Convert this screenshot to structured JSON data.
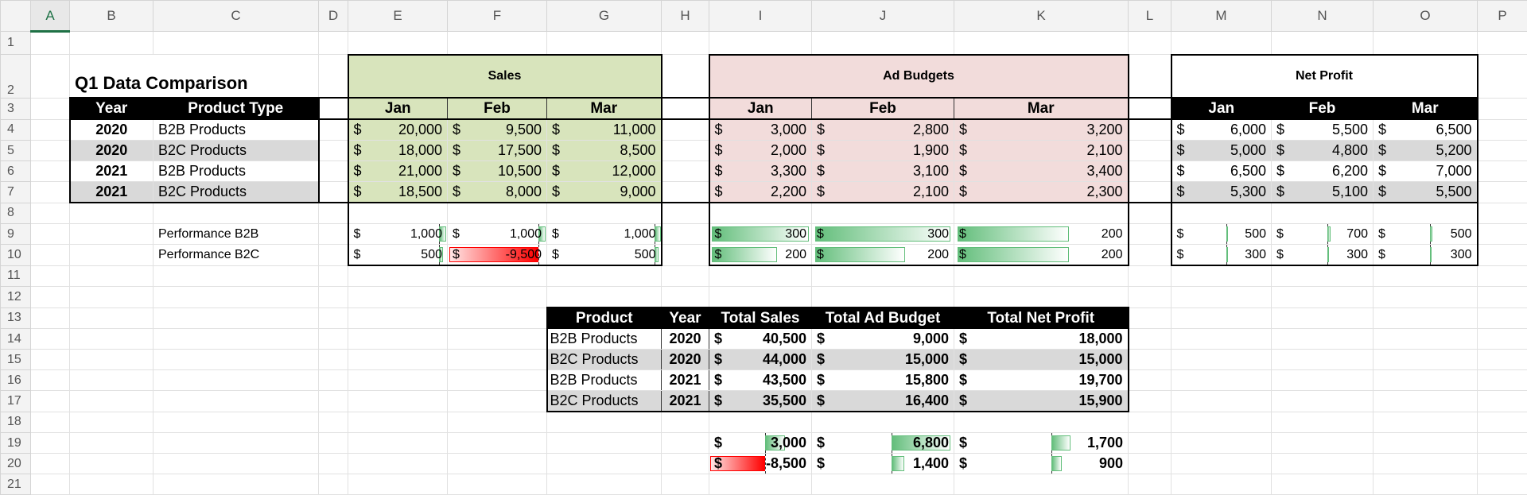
{
  "columns": [
    "A",
    "B",
    "C",
    "D",
    "E",
    "F",
    "G",
    "H",
    "I",
    "J",
    "K",
    "L",
    "M",
    "N",
    "O",
    "P"
  ],
  "rows": [
    "1",
    "2",
    "3",
    "4",
    "5",
    "6",
    "7",
    "8",
    "9",
    "10",
    "11",
    "12",
    "13",
    "14",
    "15",
    "16",
    "17",
    "18",
    "19",
    "20",
    "21"
  ],
  "currency": "$",
  "title": "Q1 Data Comparison",
  "left_table": {
    "headers": [
      "Year",
      "Product Type"
    ],
    "rows": [
      {
        "year": "2020",
        "product": "B2B Products"
      },
      {
        "year": "2020",
        "product": "B2C Products"
      },
      {
        "year": "2021",
        "product": "B2B Products"
      },
      {
        "year": "2021",
        "product": "B2C Products"
      }
    ],
    "performance_labels": [
      "Performance B2B",
      "Performance B2C"
    ]
  },
  "sales": {
    "title": "Sales",
    "months": [
      "Jan",
      "Feb",
      "Mar"
    ],
    "rows": [
      [
        "20,000",
        "9,500",
        "11,000"
      ],
      [
        "18,000",
        "17,500",
        "8,500"
      ],
      [
        "21,000",
        "10,500",
        "12,000"
      ],
      [
        "18,500",
        "8,000",
        "9,000"
      ]
    ],
    "performance": [
      [
        "1,000",
        "1,000",
        "1,000"
      ],
      [
        "500",
        "-9,500",
        "500"
      ]
    ]
  },
  "ad_budgets": {
    "title": "Ad Budgets",
    "months": [
      "Jan",
      "Feb",
      "Mar"
    ],
    "rows": [
      [
        "3,000",
        "2,800",
        "3,200"
      ],
      [
        "2,000",
        "1,900",
        "2,100"
      ],
      [
        "3,300",
        "3,100",
        "3,400"
      ],
      [
        "2,200",
        "2,100",
        "2,300"
      ]
    ],
    "performance": [
      [
        "300",
        "300",
        "200"
      ],
      [
        "200",
        "200",
        "200"
      ]
    ]
  },
  "net_profit": {
    "title": "Net Profit",
    "months": [
      "Jan",
      "Feb",
      "Mar"
    ],
    "rows": [
      [
        "6,000",
        "5,500",
        "6,500"
      ],
      [
        "5,000",
        "4,800",
        "5,200"
      ],
      [
        "6,500",
        "6,200",
        "7,000"
      ],
      [
        "5,300",
        "5,100",
        "5,500"
      ]
    ],
    "performance": [
      [
        "500",
        "700",
        "500"
      ],
      [
        "300",
        "300",
        "300"
      ]
    ]
  },
  "summary": {
    "headers": [
      "Product",
      "Year",
      "Total Sales",
      "Total Ad Budget",
      "Total Net Profit"
    ],
    "rows": [
      {
        "product": "B2B Products",
        "year": "2020",
        "sales": "40,500",
        "ad": "9,000",
        "profit": "18,000"
      },
      {
        "product": "B2C Products",
        "year": "2020",
        "sales": "44,000",
        "ad": "15,000",
        "profit": "15,000"
      },
      {
        "product": "B2B Products",
        "year": "2021",
        "sales": "43,500",
        "ad": "15,800",
        "profit": "19,700"
      },
      {
        "product": "B2C Products",
        "year": "2021",
        "sales": "35,500",
        "ad": "16,400",
        "profit": "15,900"
      }
    ],
    "differences": [
      [
        "3,000",
        "6,800",
        "1,700"
      ],
      [
        "-8,500",
        "1,400",
        "900"
      ]
    ]
  },
  "colors": {
    "sales_fill": "#d8e4bc",
    "ad_fill": "#f2dcdb",
    "band": "#d9d9d9",
    "positive_bar": "#63be7b",
    "negative_bar": "#ff0000",
    "selected_column": "#1e7145"
  }
}
